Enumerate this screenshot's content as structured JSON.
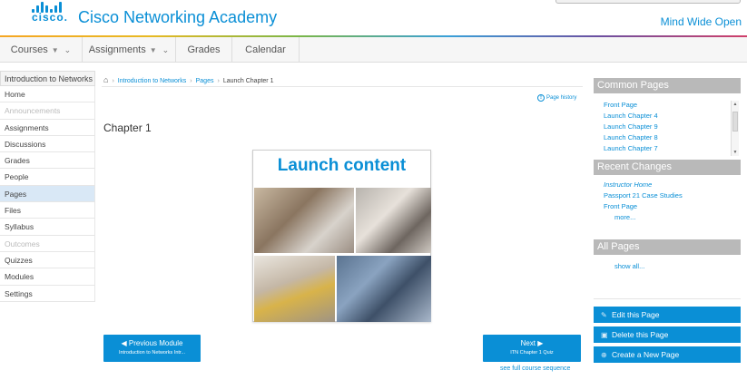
{
  "header": {
    "logo_text": "cisco.",
    "title": "Cisco Networking Academy",
    "tagline": "Mind Wide Open"
  },
  "topnav": {
    "courses": "Courses",
    "assignments": "Assignments",
    "grades": "Grades",
    "calendar": "Calendar"
  },
  "sidebar": {
    "course_title": "Introduction to Networks",
    "items": [
      {
        "label": "Home"
      },
      {
        "label": "Announcements"
      },
      {
        "label": "Assignments"
      },
      {
        "label": "Discussions"
      },
      {
        "label": "Grades"
      },
      {
        "label": "People"
      },
      {
        "label": "Pages"
      },
      {
        "label": "Files"
      },
      {
        "label": "Syllabus"
      },
      {
        "label": "Outcomes"
      },
      {
        "label": "Quizzes"
      },
      {
        "label": "Modules"
      },
      {
        "label": "Settings"
      }
    ]
  },
  "breadcrumb": {
    "course": "Introduction to Networks",
    "pages": "Pages",
    "current": "Launch Chapter 1"
  },
  "page_history": "Page history",
  "content": {
    "heading": "Chapter 1",
    "launch_title": "Launch content"
  },
  "prev_button": {
    "label": "◀ Previous Module",
    "sub": "Introduction to Networks Intr..."
  },
  "next_button": {
    "label": "Next ▶",
    "sub": "ITN Chapter 1 Quiz"
  },
  "full_sequence": "see full course sequence",
  "right_sidebar": {
    "common_pages": {
      "title": "Common Pages",
      "links": [
        "Front Page",
        "Launch Chapter 4",
        "Launch Chapter 9",
        "Launch Chapter 8",
        "Launch Chapter 7"
      ]
    },
    "recent_changes": {
      "title": "Recent Changes",
      "links": [
        "Instructor Home",
        "Passport 21 Case Studies",
        "Front Page"
      ],
      "more": "more..."
    },
    "all_pages": {
      "title": "All Pages",
      "show_all": "show all..."
    },
    "actions": {
      "edit": "Edit this Page",
      "delete": "Delete this Page",
      "create": "Create a New Page"
    }
  },
  "colors": {
    "brand": "#0a8fd6",
    "panel_header": "#b9b9b9",
    "active_sidebar": "#d9e8f6"
  }
}
